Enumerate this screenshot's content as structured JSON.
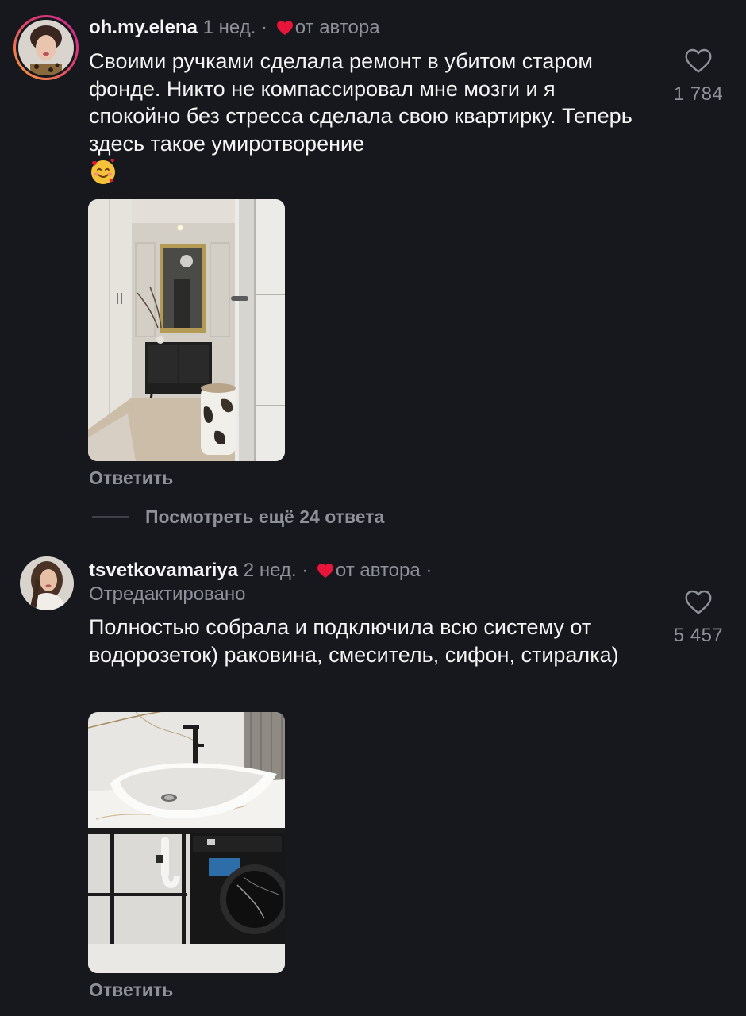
{
  "comments": [
    {
      "username": "oh.my.elena",
      "time": "1 нед.",
      "separator": "·",
      "author_label": "от автора",
      "edited": "",
      "text": "Своими ручками сделала ремонт в убитом старом фонде. Никто не компассировал мне мозги и я спокойно без стресса сделала свою квартирку. Теперь здесь такое умиротворение",
      "emoji": "smiling-face-with-hearts",
      "likes": "1 784",
      "reply_label": "Ответить"
    },
    {
      "username": "tsvetkovamariya",
      "time": "2 нед.",
      "separator": "·",
      "author_label": "от автора",
      "trailing_separator": "·",
      "edited": "Отредактировано",
      "text": "Полностью собрала и подключила всю систему от водорозеток) раковина, смеситель, сифон, стиралка)",
      "likes": "5 457",
      "reply_label": "Ответить"
    }
  ],
  "view_more": "Посмотреть ещё 24 ответа",
  "colors": {
    "background": "#16181d",
    "text": "#f4f4f4",
    "secondary": "#8e9199",
    "heart_red": "#e8153a",
    "story_ring_start": "#f9a23c",
    "story_ring_end": "#d22d8c"
  },
  "icons": {
    "like": "heart-outline-icon",
    "author_like": "heart-filled-icon"
  }
}
